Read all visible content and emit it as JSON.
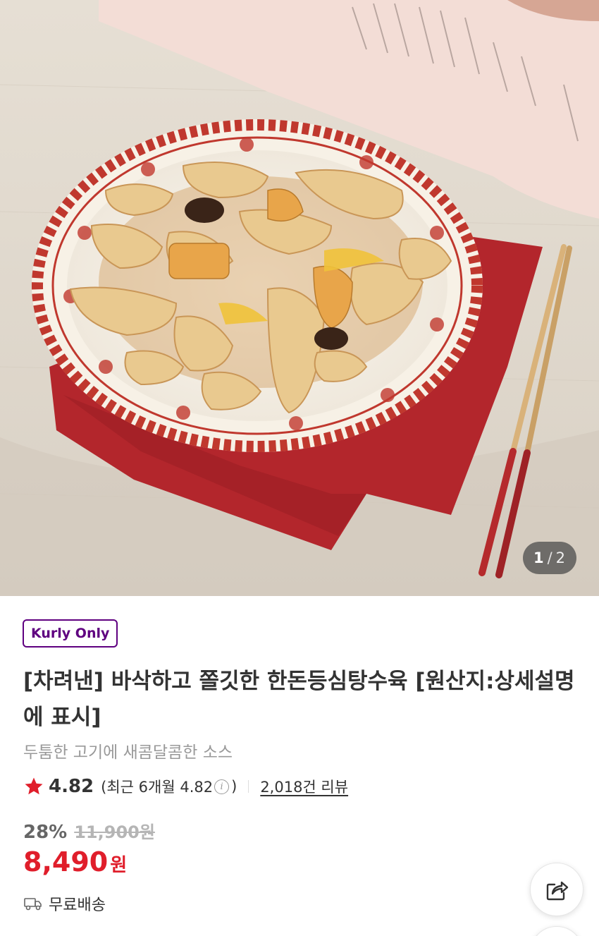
{
  "gallery": {
    "current": "1",
    "separator": "/",
    "total": "2",
    "image_alt": "plate-of-sweet-and-sour-pork-icon"
  },
  "product": {
    "badge": "Kurly Only",
    "title": "[차려낸] 바삭하고 쫄깃한 한돈등심탕수육 [원산지:상세설명에 표시]",
    "subtitle": "두툼한 고기에 새콤달콤한 소스",
    "rating": "4.82",
    "recent_rating_prefix": "(최근 6개월 4.82",
    "recent_rating_suffix": ")",
    "review_count": "2,018건 리뷰",
    "discount": "28%",
    "original_price": "11,900원",
    "price": "8,490",
    "currency": "원",
    "delivery": "무료배송"
  },
  "colors": {
    "brand": "#5f0080",
    "price": "#e01e2b",
    "star": "#e01e2b"
  },
  "icons": {
    "star": "star-icon",
    "info": "info-icon",
    "truck": "truck-icon",
    "share": "share-icon"
  }
}
